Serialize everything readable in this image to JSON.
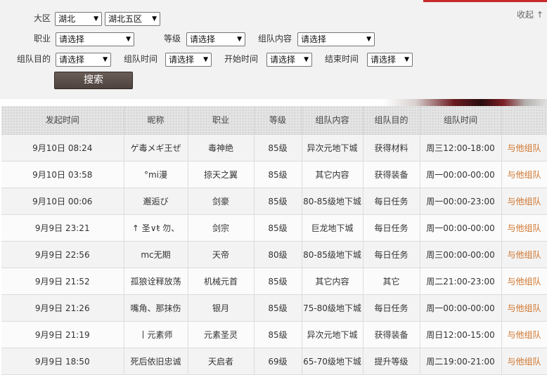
{
  "filters": {
    "region_label": "大区",
    "region_value": "湖北",
    "server_value": "湖北五区",
    "job_label": "职业",
    "job_value": "请选择",
    "level_label": "等级",
    "level_value": "请选择",
    "content_label": "组队内容",
    "content_value": "请选择",
    "purpose_label": "组队目的",
    "purpose_value": "请选择",
    "time_label": "组队时间",
    "time_value": "请选择",
    "start_label": "开始时间",
    "start_value": "请选择",
    "end_label": "结束时间",
    "end_value": "请选择",
    "collapse_label": "收起 ↑",
    "search_label": "搜索"
  },
  "table": {
    "headers": [
      "发起时间",
      "昵称",
      "职业",
      "等级",
      "组队内容",
      "组队目的",
      "组队时间",
      ""
    ],
    "rows": [
      [
        "9月10日 08:24",
        "ゲ毒メギ王ぜ",
        "毒神绝",
        "85级",
        "异次元地下城",
        "获得材料",
        "周三12:00-18:00",
        "与他组队"
      ],
      [
        "9月10日 03:58",
        "°mi漫",
        "掠天之翼",
        "85级",
        "其它内容",
        "获得装备",
        "周一00:00-00:00",
        "与他组队"
      ],
      [
        "9月10日 00:06",
        "邂逅び",
        "剑豪",
        "85级",
        "80-85级地下城",
        "每日任务",
        "周一00:00-23:00",
        "与他组队"
      ],
      [
        "9月9日 23:21",
        "↑ 圣∨ŧ 勿、",
        "剑宗",
        "85级",
        "巨龙地下城",
        "每日任务",
        "周一00:00-00:00",
        "与他组队"
      ],
      [
        "9月9日 22:56",
        "mc无期",
        "天帝",
        "80级",
        "80-85级地下城",
        "每日任务",
        "周三00:00-00:00",
        "与他组队"
      ],
      [
        "9月9日 21:52",
        "孤狼诠释放荡",
        "机械元首",
        "85级",
        "其它内容",
        "其它",
        "周二21:00-23:00",
        "与他组队"
      ],
      [
        "9月9日 21:26",
        "嘴角、那抹伤",
        "银月",
        "85级",
        "75-80级地下城",
        "每日任务",
        "周一00:00-00:00",
        "与他组队"
      ],
      [
        "9月9日 21:19",
        "丨元素师",
        "元素圣灵",
        "85级",
        "异次元地下城",
        "获得装备",
        "周日12:00-15:00",
        "与他组队"
      ],
      [
        "9月9日 18:50",
        "死后依旧忠诚",
        "天启者",
        "69级",
        "65-70级地下城",
        "提升等级",
        "周二19:00-21:00",
        "与他组队"
      ]
    ]
  }
}
